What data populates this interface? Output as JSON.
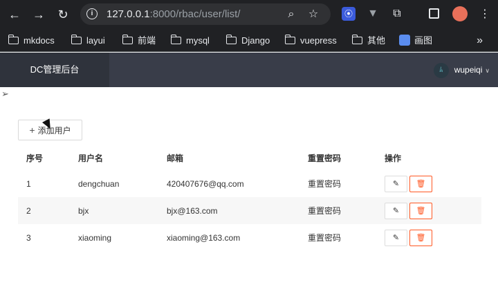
{
  "browser": {
    "url_host": "127.0.0.1",
    "url_rest": ":8000/rbac/user/list/",
    "bookmarks": [
      "mkdocs",
      "layui",
      "前端",
      "mysql",
      "Django",
      "vuepress",
      "其他",
      "画图"
    ],
    "more_label": "»"
  },
  "header": {
    "brand": "DC管理后台",
    "username": "wupeiqi",
    "avatar_text": "ﾑ"
  },
  "toolbar": {
    "add_label": "添加用户"
  },
  "table": {
    "columns": [
      "序号",
      "用户名",
      "邮箱",
      "重置密码",
      "操作"
    ],
    "rows": [
      {
        "id": "1",
        "username": "dengchuan",
        "email": "420407676@qq.com",
        "reset": "重置密码"
      },
      {
        "id": "2",
        "username": "bjx",
        "email": "bjx@163.com",
        "reset": "重置密码"
      },
      {
        "id": "3",
        "username": "xiaoming",
        "email": "xiaoming@163.com",
        "reset": "重置密码"
      }
    ]
  },
  "colors": {
    "header_bg": "#393d49",
    "brand_bg": "#2f333c",
    "danger": "#ff5722"
  }
}
